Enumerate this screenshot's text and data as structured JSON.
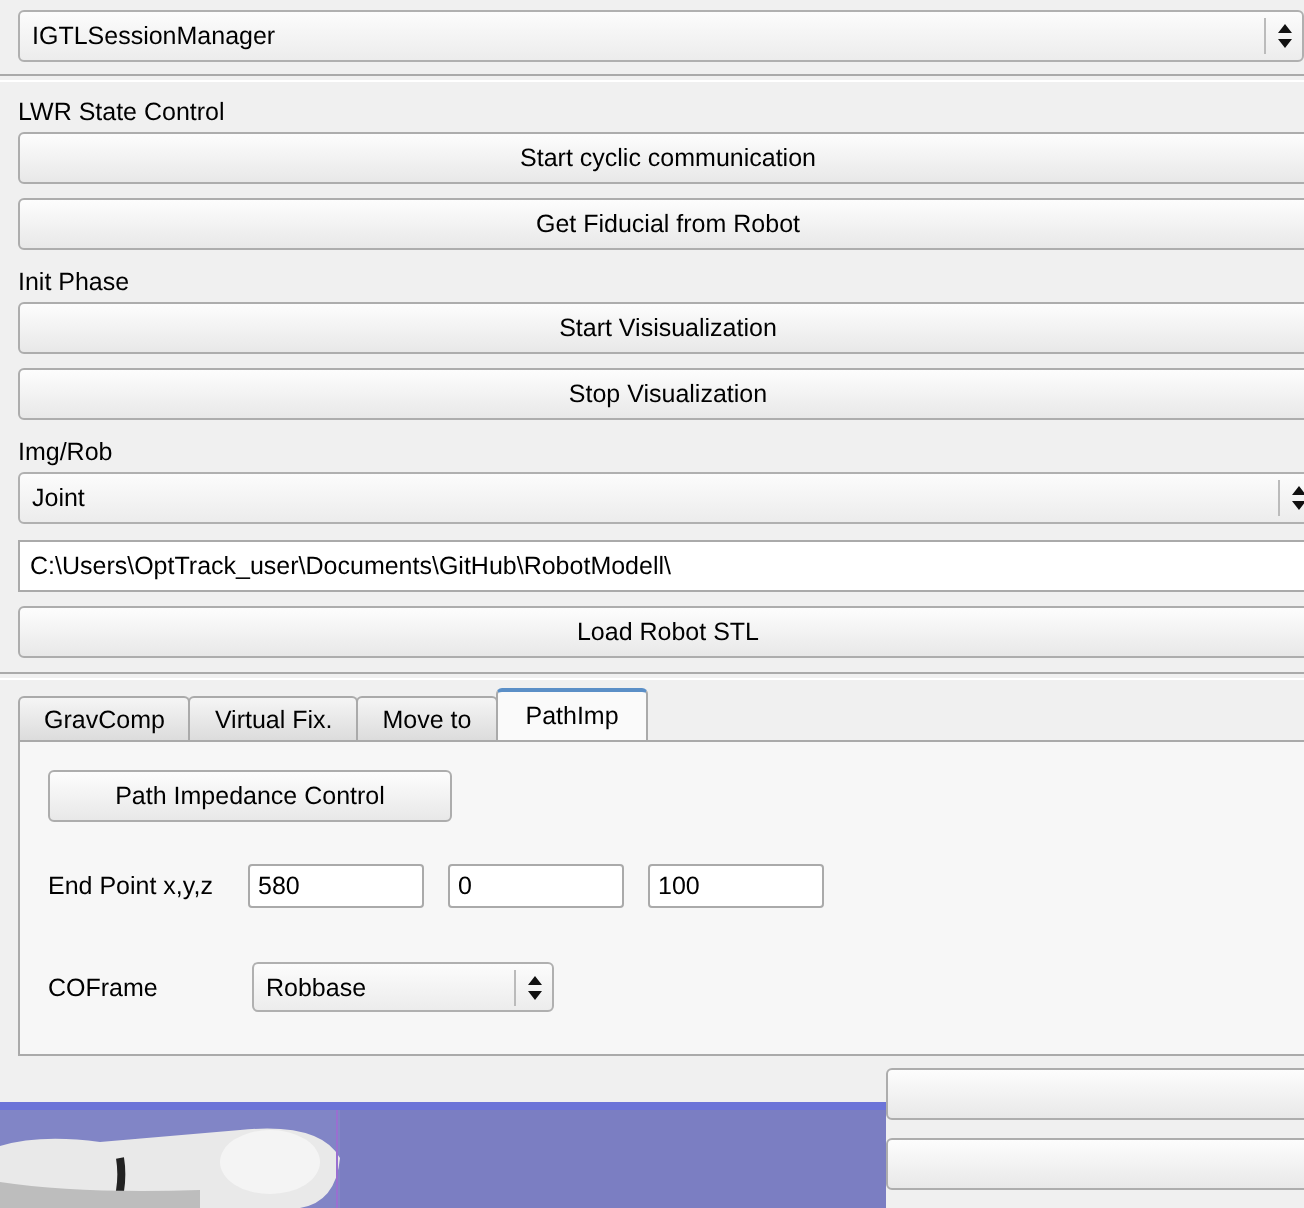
{
  "module_selector": {
    "value": "IGTLSessionManager"
  },
  "sections": [
    {
      "kind": "label",
      "text": "LWR State Control"
    },
    {
      "kind": "button",
      "text": "Start cyclic communication"
    },
    {
      "kind": "button",
      "text": "Get Fiducial from Robot"
    },
    {
      "kind": "label",
      "text": "Init Phase"
    },
    {
      "kind": "button",
      "text": "Start Visisualization"
    },
    {
      "kind": "button",
      "text": "Stop Visualization"
    },
    {
      "kind": "label",
      "text": "Img/Rob"
    },
    {
      "kind": "combo",
      "text": "Joint"
    },
    {
      "kind": "field",
      "text": "C:\\Users\\OptTrack_user\\Documents\\GitHub\\RobotModell\\"
    },
    {
      "kind": "button",
      "text": "Load Robot STL"
    }
  ],
  "tabs": [
    {
      "label": "GravComp",
      "selected": false
    },
    {
      "label": "Virtual Fix.",
      "selected": false
    },
    {
      "label": "Move to",
      "selected": false
    },
    {
      "label": "PathImp",
      "selected": true
    }
  ],
  "path_imp": {
    "button": "Path Impedance Control",
    "end_point_label": "End Point x,y,z",
    "end_point": [
      "580",
      "0",
      "100"
    ],
    "coframe_label": "COFrame",
    "coframe": "Robbase"
  }
}
